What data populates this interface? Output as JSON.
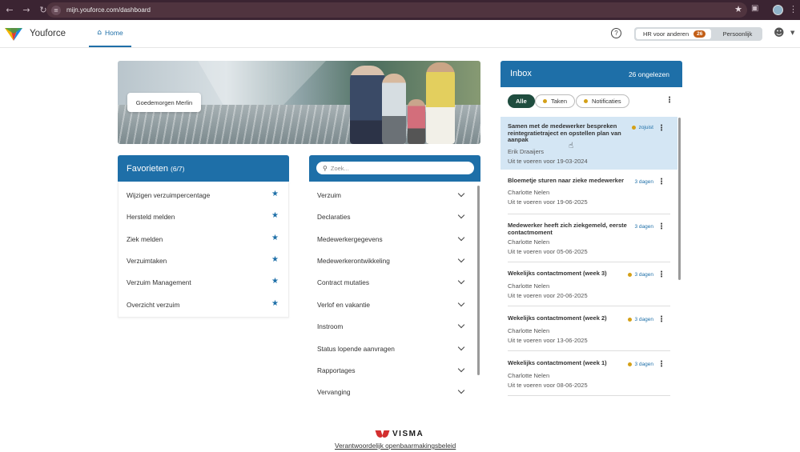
{
  "browser": {
    "url": "mijn.youforce.com/dashboard",
    "back_icon": "arrow-left",
    "forward_icon": "arrow-right",
    "reload_icon": "reload"
  },
  "header": {
    "brand": "Youforce",
    "nav_home": "Home",
    "help": "?",
    "toggle_hr": "HR voor anderen",
    "toggle_hr_badge": "26",
    "toggle_personal": "Persoonlijk"
  },
  "hero": {
    "greeting": "Goedemorgen Merlin"
  },
  "favorites": {
    "title": "Favorieten",
    "count": "(6/7)",
    "items": [
      "Wijzigen verzuimpercentage",
      "Hersteld melden",
      "Ziek melden",
      "Verzuimtaken",
      "Verzuim Management",
      "Overzicht verzuim"
    ]
  },
  "menu": {
    "search_placeholder": "Zoek...",
    "items": [
      "Verzuim",
      "Declaraties",
      "Medewerkergegevens",
      "Medewerkerontwikkeling",
      "Contract mutaties",
      "Verlof en vakantie",
      "Instroom",
      "Status lopende aanvragen",
      "Rapportages",
      "Vervanging"
    ]
  },
  "inbox": {
    "title": "Inbox",
    "unread": "26 ongelezen",
    "filters": [
      "Alle",
      "Taken",
      "Notificaties"
    ],
    "cards": [
      {
        "title": "Samen met de medewerker bespreken reintegratietraject en opstellen plan van aanpak",
        "meta": "zojuist",
        "name": "Erik Draaijers",
        "due": "Uit te voeren voor 19-03-2024"
      },
      {
        "title": "Bloemetje sturen naar zieke medewerker",
        "meta": "3 dagen",
        "name": "Charlotte Nelen",
        "due": "Uit te voeren voor 19-06-2025"
      },
      {
        "title": "Medewerker heeft zich ziekgemeld, eerste contactmoment",
        "meta": "3 dagen",
        "name": "Charlotte Nelen",
        "due": "Uit te voeren voor 05-06-2025"
      },
      {
        "title": "Wekelijks contactmoment (week 3)",
        "meta": "3 dagen",
        "name": "Charlotte Nelen",
        "due": "Uit te voeren voor 20-06-2025"
      },
      {
        "title": "Wekelijks contactmoment (week 2)",
        "meta": "3 dagen",
        "name": "Charlotte Nelen",
        "due": "Uit te voeren voor 13-06-2025"
      },
      {
        "title": "Wekelijks contactmoment (week 1)",
        "meta": "3 dagen",
        "name": "Charlotte Nelen",
        "due": "Uit te voeren voor 08-06-2025"
      }
    ]
  },
  "footer": {
    "brand": "VISMA",
    "link": "Verantwoordelijk openbaarmakingsbeleid"
  },
  "colors": {
    "primary": "#1e6fa8",
    "chrome": "#3b2432",
    "badge": "#c25e16",
    "active_chip": "#1f4d3f",
    "selected_card": "#d4e6f4",
    "status_dot": "#d4a017"
  }
}
